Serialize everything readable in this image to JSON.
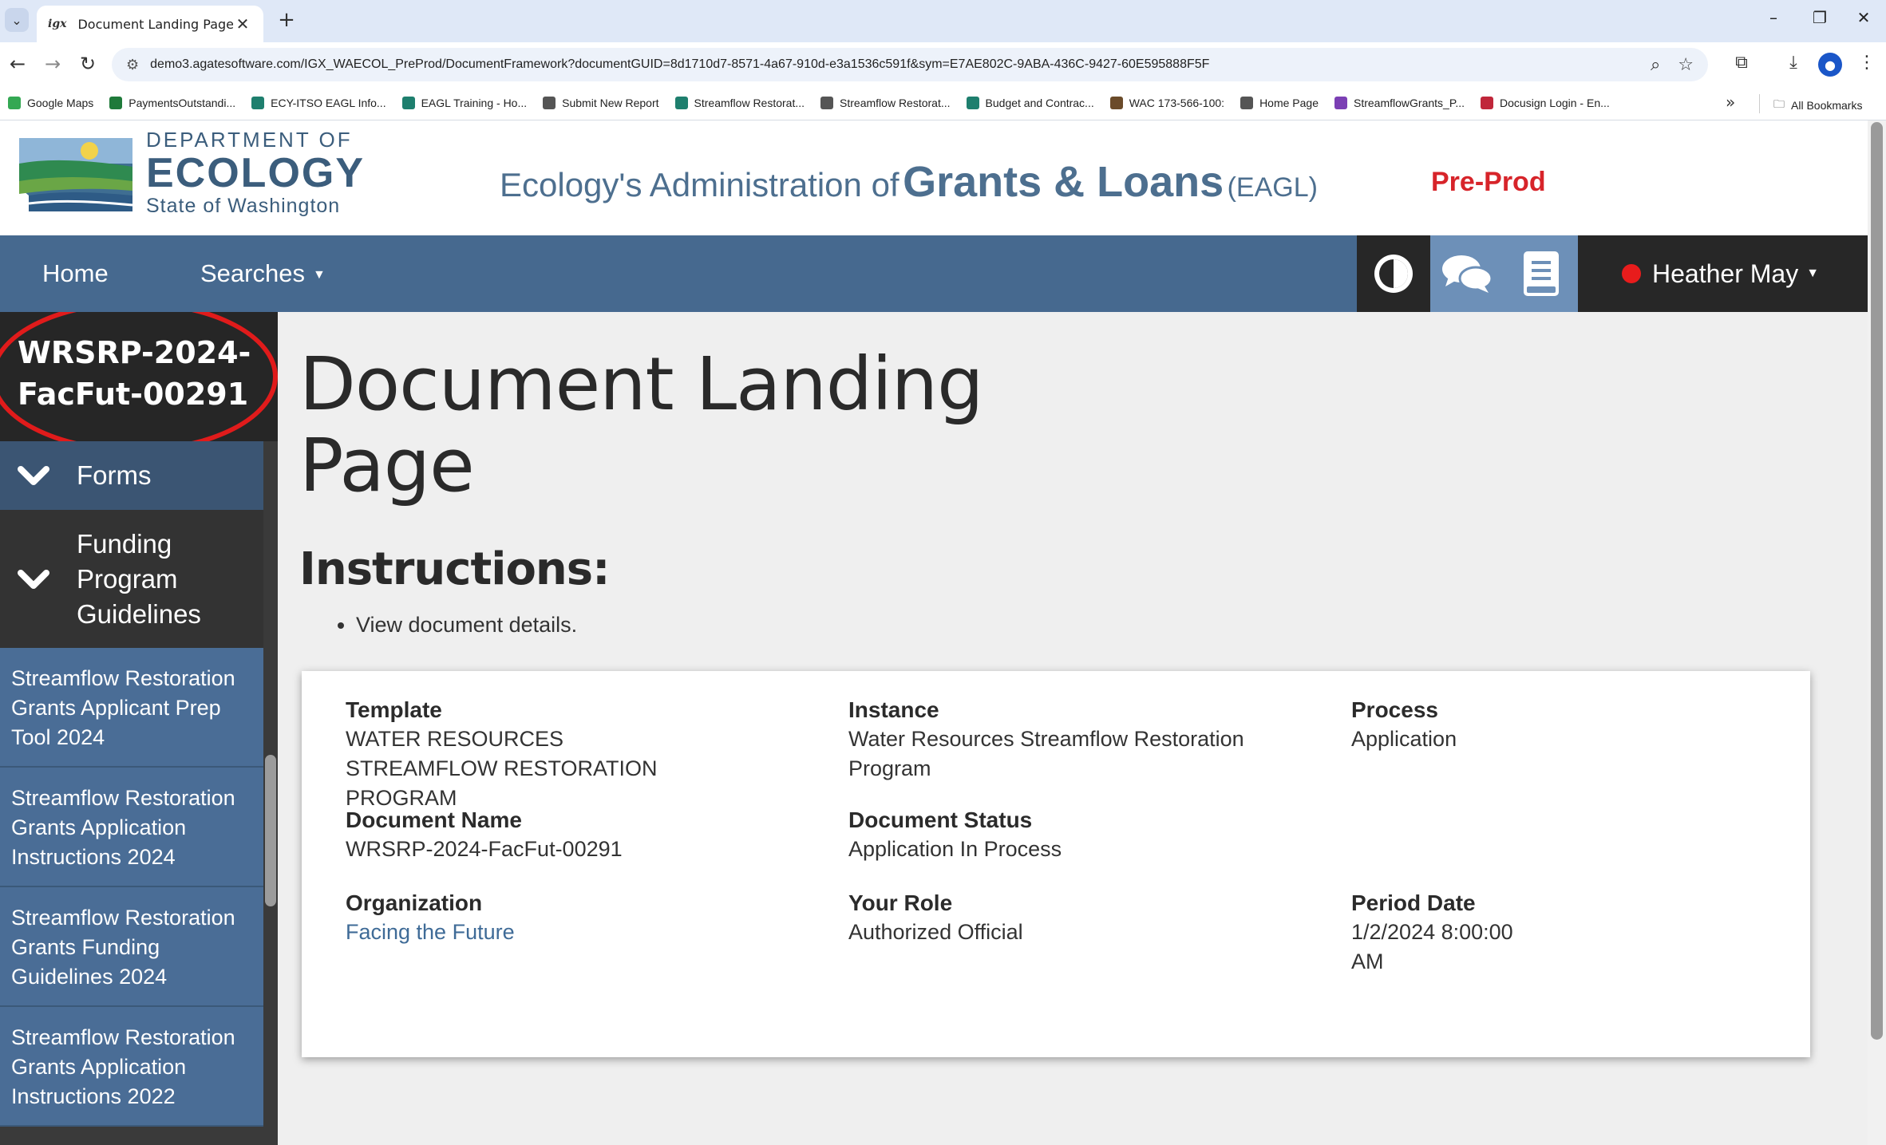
{
  "browser": {
    "tab_title": "Document Landing Page",
    "tab_favicon": "igx",
    "url": "demo3.agatesoftware.com/IGX_WAECOL_PreProd/DocumentFramework?documentGUID=8d1710d7-8571-4a67-910d-e3a1536c591f&sym=E7AE802C-9ABA-436C-9427-60E595888F5F",
    "bookmarks": [
      {
        "label": "Google Maps",
        "color": "#34a853"
      },
      {
        "label": "PaymentsOutstandi...",
        "color": "#1f7a3a"
      },
      {
        "label": "ECY-ITSO EAGL Info...",
        "color": "#1e7f6e"
      },
      {
        "label": "EAGL Training - Ho...",
        "color": "#1e7f6e"
      },
      {
        "label": "Submit New Report",
        "color": "#555555"
      },
      {
        "label": "Streamflow Restorat...",
        "color": "#1e7f6e"
      },
      {
        "label": "Streamflow Restorat...",
        "color": "#555555"
      },
      {
        "label": "Budget and Contrac...",
        "color": "#1e7f6e"
      },
      {
        "label": "WAC 173-566-100:",
        "color": "#6b4b2a"
      },
      {
        "label": "Home Page",
        "color": "#555555"
      },
      {
        "label": "StreamflowGrants_P...",
        "color": "#7b3fb4"
      },
      {
        "label": "Docusign Login - En...",
        "color": "#c0263a"
      }
    ],
    "all_bookmarks": "All Bookmarks"
  },
  "header": {
    "logo_line1": "DEPARTMENT OF",
    "logo_line2": "ECOLOGY",
    "logo_line3": "State of Washington",
    "title_part1": "Ecology's Administration of",
    "title_part2": "Grants & Loans",
    "title_part3": "(EAGL)",
    "env_badge": "Pre-Prod"
  },
  "nav": {
    "home": "Home",
    "searches": "Searches",
    "user": "Heather May"
  },
  "sidebar": {
    "document_id": "WRSRP-2024-FacFut-00291",
    "forms": "Forms",
    "funding": "Funding Program Guidelines",
    "links": [
      "Streamflow Restoration Grants Applicant Prep Tool 2024",
      "Streamflow Restoration Grants Application Instructions 2024",
      "Streamflow Restoration Grants Funding Guidelines 2024",
      "Streamflow Restoration Grants Application Instructions 2022"
    ]
  },
  "main": {
    "title": "Document Landing Page",
    "instructions_heading": "Instructions:",
    "instructions": [
      "View document details."
    ],
    "fields": {
      "template_label": "Template",
      "template_value": "WATER RESOURCES STREAMFLOW RESTORATION PROGRAM",
      "instance_label": "Instance",
      "instance_value": "Water Resources Streamflow Restoration Program",
      "process_label": "Process",
      "process_value": "Application",
      "docname_label": "Document Name",
      "docname_value": "WRSRP-2024-FacFut-00291",
      "docstatus_label": "Document Status",
      "docstatus_value": "Application In Process",
      "org_label": "Organization",
      "org_value": "Facing the Future",
      "role_label": "Your Role",
      "role_value": "Authorized Official",
      "period_label": "Period Date",
      "period_value": "1/2/2024 8:00:00 AM"
    }
  },
  "colors": {
    "nav_bg": "#46698f",
    "sidebar_link_bg": "#4a6d96",
    "preprod_red": "#d7242a",
    "status_red": "#e81c1c"
  }
}
